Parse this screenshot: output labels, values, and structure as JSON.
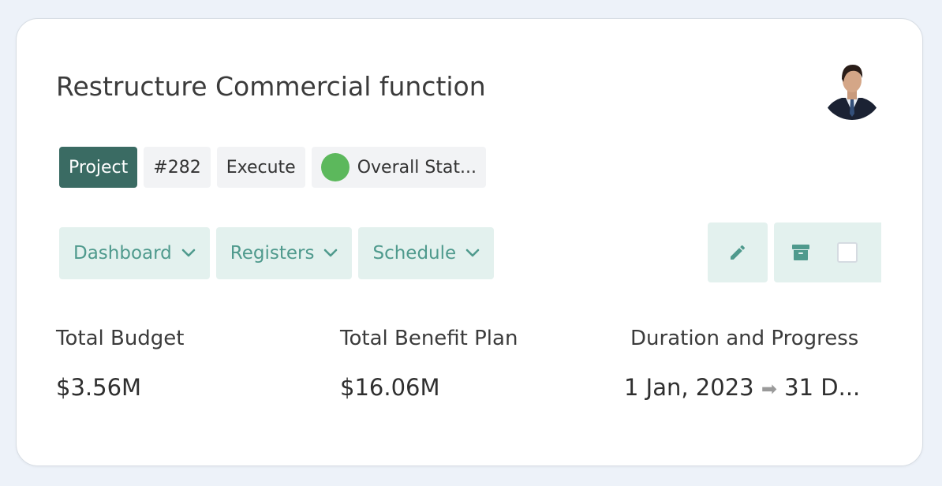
{
  "card": {
    "title": "Restructure Commercial function",
    "tags": {
      "type": "Project",
      "id": "#282",
      "phase": "Execute",
      "status_label": "Overall Stat...",
      "status_color": "#5cb85c"
    },
    "menus": [
      {
        "label": "Dashboard"
      },
      {
        "label": "Registers"
      },
      {
        "label": "Schedule"
      }
    ],
    "actions": {
      "edit_icon": "pencil-icon",
      "archive_icon": "archive-box-icon",
      "select_checked": false
    },
    "metrics": {
      "budget": {
        "label": "Total Budget",
        "value": "$3.56M"
      },
      "benefit": {
        "label": "Total Benefit Plan",
        "value": "$16.06M"
      },
      "duration": {
        "label": "Duration and Progress",
        "start": "1 Jan, 2023",
        "arrow": "➡",
        "end": "31 D..."
      }
    }
  },
  "colors": {
    "accent": "#3a6b63",
    "menu_bg": "#e3f1ee",
    "menu_text": "#4f9a8d",
    "tag_bg": "#f2f3f5",
    "page_bg": "#edf2f9"
  }
}
